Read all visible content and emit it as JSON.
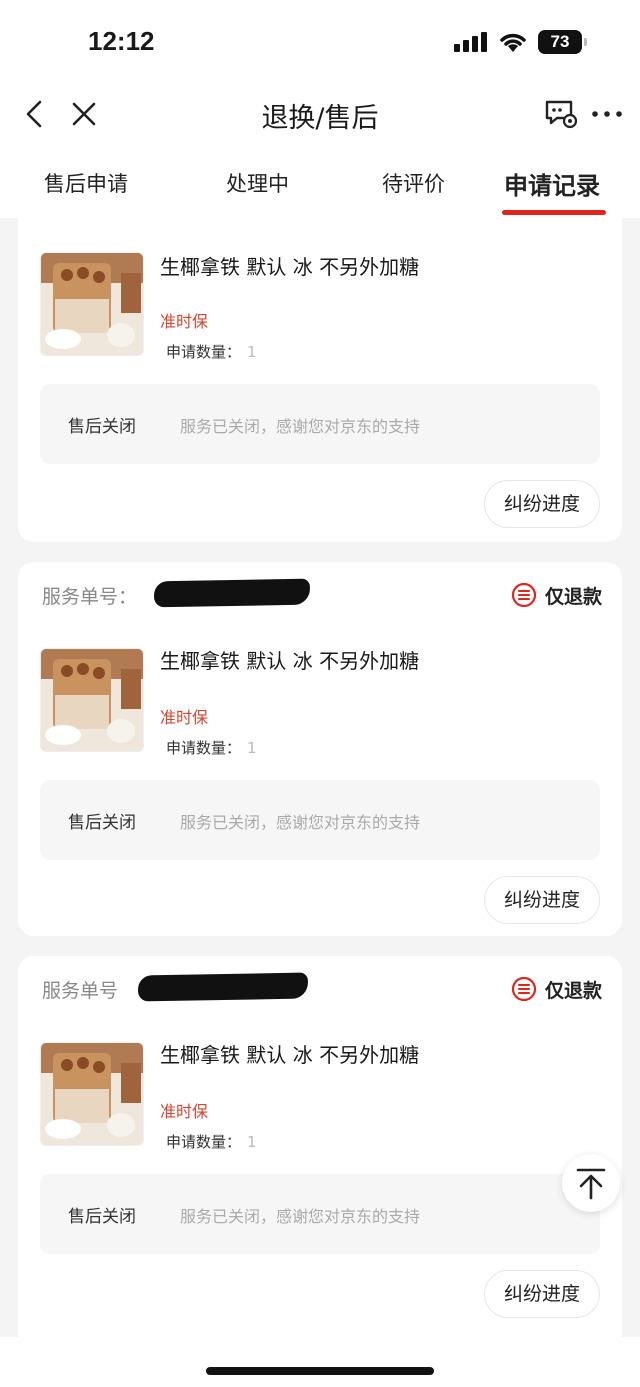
{
  "status_bar": {
    "time": "12:12",
    "battery": "73"
  },
  "nav": {
    "title": "退换/售后"
  },
  "tabs": [
    {
      "label": "售后申请",
      "active": false
    },
    {
      "label": "处理中",
      "active": false
    },
    {
      "label": "待评价",
      "active": false
    },
    {
      "label": "申请记录",
      "active": true
    }
  ],
  "colors": {
    "accent": "#e1251b",
    "tag_red": "#d9432e"
  },
  "cards": [
    {
      "service_no_label": "",
      "type": "",
      "product_name": "生椰拿铁 默认 冰 不另外加糖",
      "tag": "准时保",
      "qty_label": "申请数量：",
      "qty": "1",
      "status_label": "售后关闭",
      "status_msg": "服务已关闭，感谢您对京东的支持",
      "button": "纠纷进度"
    },
    {
      "service_no_label": "服务单号：",
      "type": "仅退款",
      "product_name": "生椰拿铁 默认 冰 不另外加糖",
      "tag": "准时保",
      "qty_label": "申请数量：",
      "qty": "1",
      "status_label": "售后关闭",
      "status_msg": "服务已关闭，感谢您对京东的支持",
      "button": "纠纷进度"
    },
    {
      "service_no_label": "服务单号",
      "type": "仅退款",
      "product_name": "生椰拿铁 默认 冰 不另外加糖",
      "tag": "准时保",
      "qty_label": "申请数量：",
      "qty": "1",
      "status_label": "售后关闭",
      "status_msg": "服务已关闭，感谢您对京东的支持",
      "button": "纠纷进度"
    }
  ]
}
